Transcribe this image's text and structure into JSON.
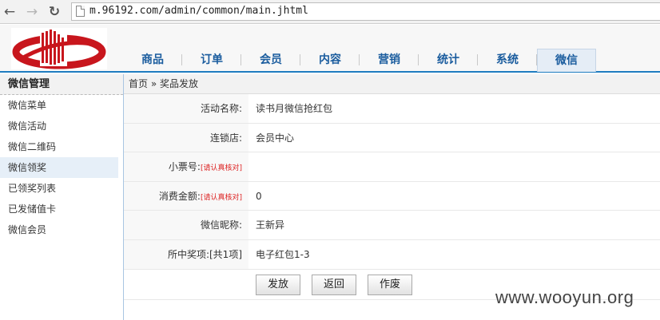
{
  "browser": {
    "url": "m.96192.com/admin/common/main.jhtml"
  },
  "header": {
    "nav": [
      {
        "label": "商品"
      },
      {
        "label": "订单"
      },
      {
        "label": "会员"
      },
      {
        "label": "内容"
      },
      {
        "label": "营销"
      },
      {
        "label": "统计"
      },
      {
        "label": "系统"
      },
      {
        "label": "微信"
      }
    ],
    "active_nav": "微信"
  },
  "sidebar": {
    "title": "微信管理",
    "items": [
      {
        "label": "微信菜单"
      },
      {
        "label": "微信活动"
      },
      {
        "label": "微信二维码"
      },
      {
        "label": "微信领奖"
      },
      {
        "label": "已领奖列表"
      },
      {
        "label": "已发储值卡"
      },
      {
        "label": "微信会员"
      }
    ],
    "active_item": "微信领奖"
  },
  "breadcrumb": "首页 » 奖品发放",
  "form": {
    "rows": [
      {
        "label": "活动名称:",
        "value": "读书月微信抢红包",
        "note": ""
      },
      {
        "label": "连锁店:",
        "value": "会员中心",
        "note": ""
      },
      {
        "label": "小票号:",
        "value": "",
        "note": "[请认真核对]"
      },
      {
        "label": "消费金额:",
        "value": "0",
        "note": "[请认真核对]"
      },
      {
        "label": "微信昵称:",
        "value": "王新异",
        "note": ""
      },
      {
        "label": "所中奖项:[共1项]",
        "value": "电子红包1-3",
        "note": ""
      }
    ],
    "buttons": {
      "issue": "发放",
      "back": "返回",
      "void": "作废"
    }
  },
  "watermark": "www.wooyun.org",
  "colors": {
    "accent": "#1f7cc0",
    "nav_text": "#1a5c9e",
    "note": "#d22222",
    "logo_red": "#c8161d"
  }
}
